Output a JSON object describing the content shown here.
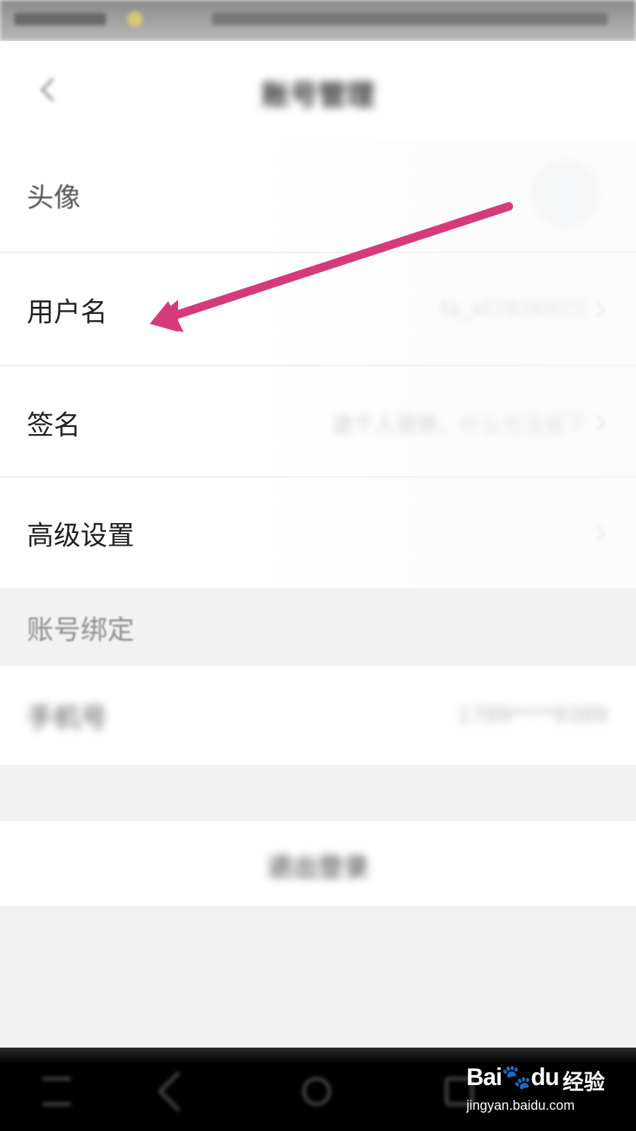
{
  "header": {
    "title": "账号管理"
  },
  "rows": [
    {
      "label": "头像",
      "value": ""
    },
    {
      "label": "用户名",
      "value": "fa_xt7826925"
    },
    {
      "label": "签名",
      "value": "这个人很懒，什么也没留下"
    },
    {
      "label": "高级设置",
      "value": ""
    }
  ],
  "section": {
    "label": "账号绑定"
  },
  "phone_row": {
    "label": "手机号",
    "value": "1789****9389"
  },
  "logout": {
    "label": "退出登录"
  },
  "annotation": {
    "color": "#d63a7a"
  },
  "watermark": {
    "logo": "Bai🐾du",
    "cn": "经验",
    "url": "jingyan.baidu.com"
  }
}
